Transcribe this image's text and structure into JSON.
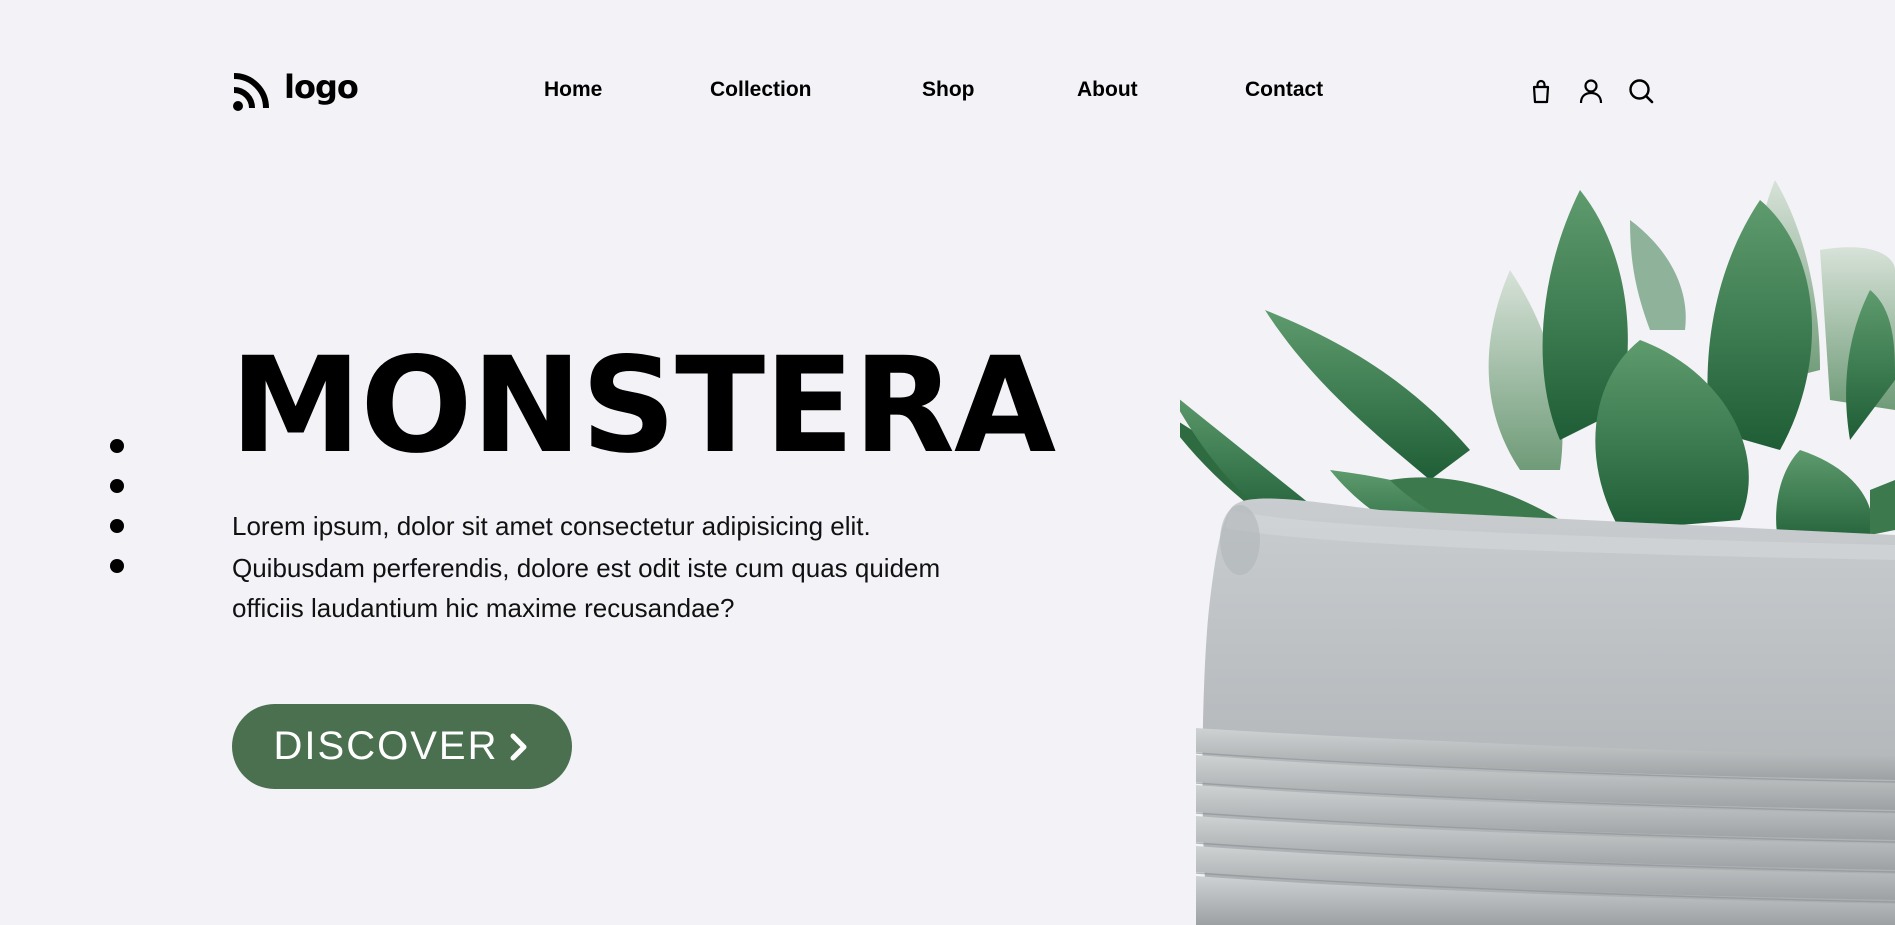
{
  "brand": {
    "logo_text": "logo",
    "logo_icon": "rss-icon"
  },
  "nav": {
    "items": [
      {
        "label": "Home"
      },
      {
        "label": "Collection"
      },
      {
        "label": "Shop"
      },
      {
        "label": "About"
      },
      {
        "label": "Contact"
      }
    ]
  },
  "header_icons": [
    "shopping-bag-icon",
    "user-icon",
    "search-icon"
  ],
  "slider": {
    "dot_count": 4
  },
  "hero": {
    "title": "MONSTERA",
    "text_line1": "Lorem ipsum, dolor sit amet consectetur adipisicing elit.",
    "text_line2": "Quibusdam perferendis, dolore est odit iste cum quas quidem officiis laudantium hic maxime recusandae?",
    "button_label": "DISCOVER",
    "button_icon": "chevron-right-icon"
  },
  "colors": {
    "background": "#f3f2f7",
    "accent": "#4a7050",
    "text": "#000000"
  }
}
